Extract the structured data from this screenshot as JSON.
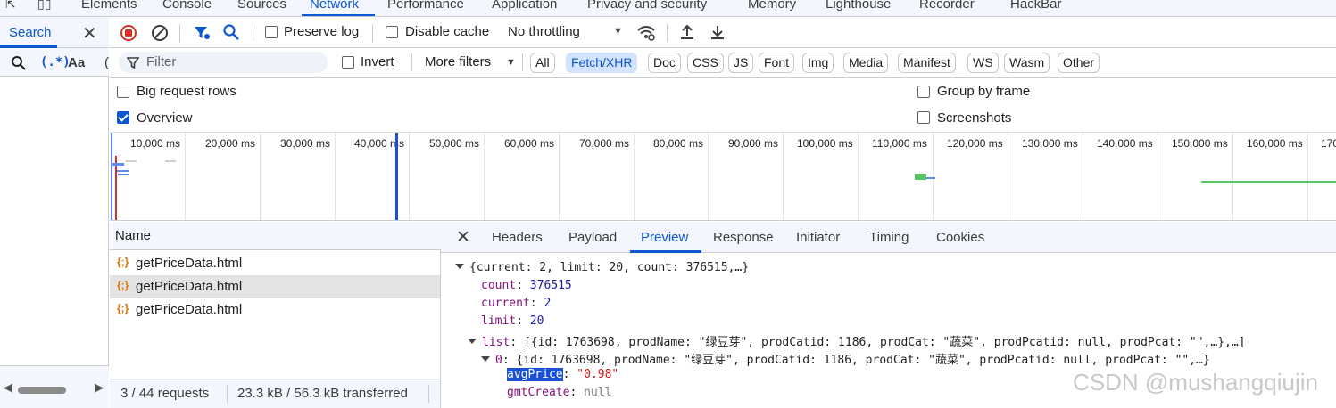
{
  "top_tabs": [
    "Elements",
    "Console",
    "Sources",
    "Network",
    "Performance",
    "Application",
    "Privacy and security",
    "Memory",
    "Lighthouse",
    "Recorder",
    "HackBar"
  ],
  "search": {
    "tab_label": "Search",
    "case_label": "Aa",
    "regex_label": "(.*)"
  },
  "toolbar": {
    "preserve_log": "Preserve log",
    "disable_cache": "Disable cache",
    "throttling": "No throttling"
  },
  "filterbar": {
    "filter_placeholder": "Filter",
    "invert": "Invert",
    "more_filters": "More filters",
    "chips": [
      "All",
      "Fetch/XHR",
      "Doc",
      "CSS",
      "JS",
      "Font",
      "Img",
      "Media",
      "Manifest",
      "WS",
      "Wasm",
      "Other"
    ],
    "active_chip": "Fetch/XHR"
  },
  "settings": {
    "big_request_rows": "Big request rows",
    "overview": "Overview",
    "group_by_frame": "Group by frame",
    "screenshots": "Screenshots"
  },
  "timeline": {
    "ticks": [
      "10,000 ms",
      "20,000 ms",
      "30,000 ms",
      "40,000 ms",
      "50,000 ms",
      "60,000 ms",
      "70,000 ms",
      "80,000 ms",
      "90,000 ms",
      "100,000 ms",
      "110,000 ms",
      "120,000 ms",
      "130,000 ms",
      "140,000 ms",
      "150,000 ms",
      "160,000 ms",
      "170"
    ]
  },
  "requests": {
    "column_name": "Name",
    "rows": [
      "getPriceData.html",
      "getPriceData.html",
      "getPriceData.html"
    ],
    "requests_count": "3 / 44 requests",
    "transferred": "23.3 kB / 56.3 kB transferred"
  },
  "detail_tabs": [
    "Headers",
    "Payload",
    "Preview",
    "Response",
    "Initiator",
    "Timing",
    "Cookies"
  ],
  "preview": {
    "root_summary": "{current: 2, limit: 20, count: 376515,…}",
    "count_key": "count",
    "count_val": "376515",
    "current_key": "current",
    "current_val": "2",
    "limit_key": "limit",
    "limit_val": "20",
    "list_key": "list",
    "list_summary": "[{id: 1763698, prodName: \"绿豆芽\", prodCatid: 1186, prodCat: \"蔬菜\", prodPcatid: null, prodPcat: \"\",…},…]",
    "item0_key": "0",
    "item0_summary": "{id: 1763698, prodName: \"绿豆芽\", prodCatid: 1186, prodCat: \"蔬菜\", prodPcatid: null, prodPcat: \"\",…}",
    "avg_key": "avgPrice",
    "avg_val": "\"0.98\"",
    "gmt_key": "gmtCreate",
    "gmt_val": "null"
  },
  "watermark": "CSDN @mushangqiujin"
}
